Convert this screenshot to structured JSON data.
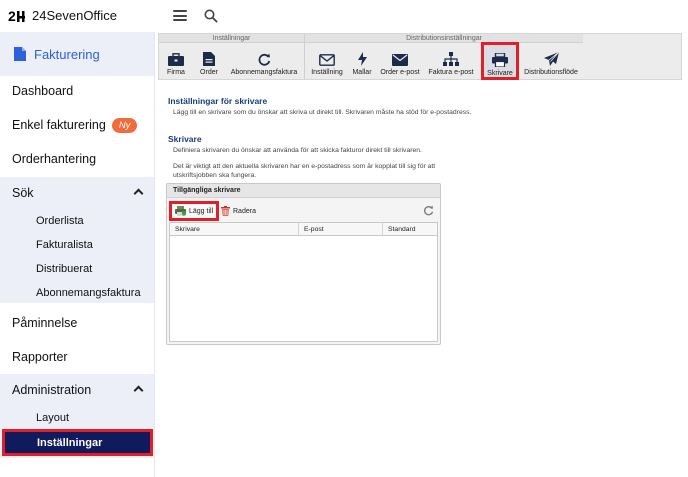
{
  "header": {
    "logo_mark": "24",
    "logo_text": "24SevenOffice"
  },
  "sidebar": {
    "app_label": "Fakturering",
    "items": [
      {
        "label": "Dashboard"
      },
      {
        "label": "Enkel fakturering",
        "badge": "Ny"
      },
      {
        "label": "Orderhantering"
      },
      {
        "label": "Sök"
      },
      {
        "label": "Påminnelse"
      },
      {
        "label": "Rapporter"
      },
      {
        "label": "Administration"
      }
    ],
    "sok_sub": [
      "Orderlista",
      "Fakturalista",
      "Distribuerat",
      "Abonnemangsfaktura"
    ],
    "admin_sub": [
      "Layout",
      "Inställningar"
    ]
  },
  "toolbar": {
    "group1_title": "Inställningar",
    "group2_title": "Distributionsinställningar",
    "buttons": [
      {
        "label": "Firma",
        "icon": "briefcase-icon"
      },
      {
        "label": "Order",
        "icon": "document-icon"
      },
      {
        "label": "Abonnemangsfaktura",
        "icon": "refresh-icon"
      },
      {
        "label": "Inställning",
        "icon": "envelope-outline-icon"
      },
      {
        "label": "Mallar",
        "icon": "bolt-icon"
      },
      {
        "label": "Order e-post",
        "icon": "envelope-icon"
      },
      {
        "label": "Faktura e-post",
        "icon": "sitemap-icon"
      },
      {
        "label": "Skrivare",
        "icon": "printer-icon",
        "active": true
      },
      {
        "label": "Distributionsflöde",
        "icon": "paper-plane-icon"
      }
    ]
  },
  "main": {
    "heading1": "Inställningar för skrivare",
    "text1": "Lägg till en skrivare som du önskar att skriva ut direkt till. Skrivaren måste ha stöd för e-postadress.",
    "heading2": "Skrivare",
    "text2": "Definiera skrivaren du önskar att använda för att skicka fakturor direkt till skrivaren.",
    "text3": "Det är viktigt att den aktuella skrivaren har en e-postadress som är kopplat till sig för att utskriftsjobben ska fungera.",
    "panel_title": "Tillgängliga skrivare",
    "add_label": "Lägg till",
    "delete_label": "Radera",
    "columns": [
      "Skrivare",
      "E-post",
      "Standard"
    ]
  },
  "colors": {
    "accent": "#2b62d9",
    "active_nav": "#111a5c",
    "highlight": "#e01f26",
    "badge": "#f26b3a"
  }
}
